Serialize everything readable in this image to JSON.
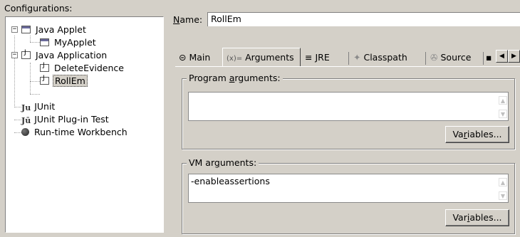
{
  "configurations": {
    "label": "Configurations:",
    "tree": [
      {
        "label": "Java Applet",
        "icon": "java-applet-icon",
        "expanded": true
      },
      {
        "label": "MyApplet",
        "icon": "applet-config-icon"
      },
      {
        "label": "Java Application",
        "icon": "java-application-icon",
        "expanded": true
      },
      {
        "label": "DeleteEvidence",
        "icon": "java-app-config-icon"
      },
      {
        "label": "RollEm",
        "icon": "java-app-config-icon",
        "selected": true
      },
      {
        "label": "JUnit",
        "icon": "junit-icon"
      },
      {
        "label": "JUnit Plug-in Test",
        "icon": "junit-plugin-icon"
      },
      {
        "label": "Run-time Workbench",
        "icon": "runtime-workbench-icon"
      }
    ]
  },
  "name": {
    "label_u": "N",
    "label_rest": "ame:",
    "value": "RollEm"
  },
  "tabs": [
    {
      "label": "Main",
      "icon": "main-tab-icon",
      "glyph": "⊝"
    },
    {
      "label": "Arguments",
      "icon": "arguments-tab-icon",
      "glyph": "(x)=",
      "active": true
    },
    {
      "label": "JRE",
      "icon": "jre-tab-icon",
      "glyph": "≡"
    },
    {
      "label": "Classpath",
      "icon": "classpath-tab-icon",
      "glyph": "✦"
    },
    {
      "label": "Source",
      "icon": "source-tab-icon",
      "glyph": "✇"
    },
    {
      "label": "",
      "icon": "more-tab-icon",
      "glyph": "▪"
    }
  ],
  "program_args": {
    "title_pre": "Program ",
    "title_u": "a",
    "title_post": "rguments:",
    "value": "",
    "button_pre": "Va",
    "button_u": "r",
    "button_post": "iables..."
  },
  "vm_args": {
    "title_pre": "VM ar",
    "title_u": "g",
    "title_post": "uments:",
    "value": "-enableassertions",
    "button_pre": "Var",
    "button_u": "i",
    "button_post": "ables..."
  }
}
